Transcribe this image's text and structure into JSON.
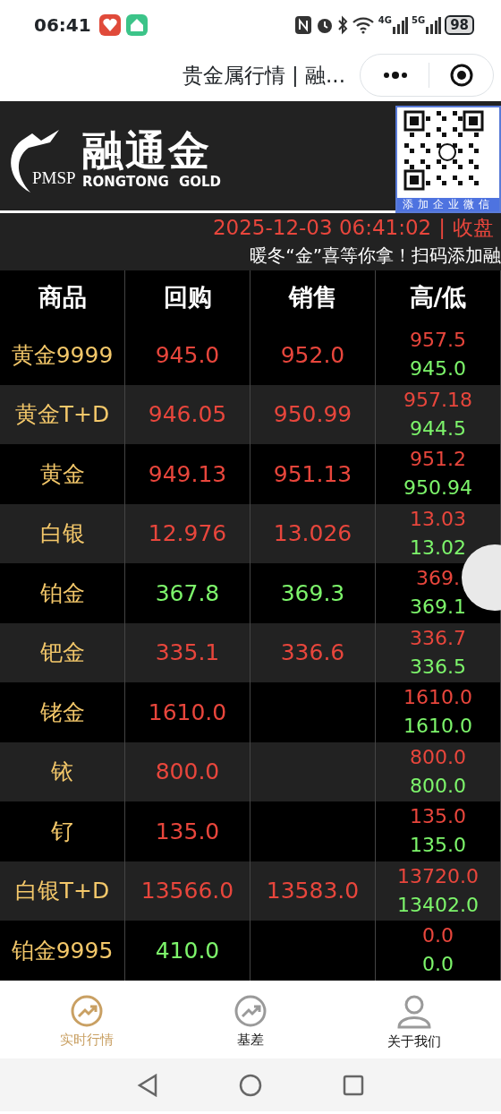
{
  "status_bar": {
    "time": "06:41",
    "network_1": "4G",
    "network_2": "5G",
    "battery": "98"
  },
  "window": {
    "title": "贵金属行情 | 融..."
  },
  "brand": {
    "emblem_text": "PMSP",
    "name": "融通金",
    "name_en": "RONGTONG GOLD",
    "qr_caption": "添加企业微信"
  },
  "market": {
    "datetime": "2025-12-03 06:41:02",
    "separator": "|",
    "status": "收盘",
    "notice": "暖冬“金”喜等你拿！扫码添加融"
  },
  "table": {
    "columns": [
      "商品",
      "回购",
      "销售",
      "高/低"
    ],
    "rows": [
      {
        "name": "黄金9999",
        "buy": "945.0",
        "sell": "952.0",
        "color": "#e8463c",
        "high": "957.5",
        "low": "945.0"
      },
      {
        "name": "黄金T+D",
        "buy": "946.05",
        "sell": "950.99",
        "color": "#e8463c",
        "high": "957.18",
        "low": "944.5"
      },
      {
        "name": "黄金",
        "buy": "949.13",
        "sell": "951.13",
        "color": "#e8463c",
        "high": "951.2",
        "low": "950.94"
      },
      {
        "name": "白银",
        "buy": "12.976",
        "sell": "13.026",
        "color": "#e8463c",
        "high": "13.03",
        "low": "13.02"
      },
      {
        "name": "铂金",
        "buy": "367.8",
        "sell": "369.3",
        "color": "#7df56b",
        "high": "369.",
        "low": "369.1"
      },
      {
        "name": "钯金",
        "buy": "335.1",
        "sell": "336.6",
        "color": "#e8463c",
        "high": "336.7",
        "low": "336.5"
      },
      {
        "name": "铑金",
        "buy": "1610.0",
        "color": "#e8463c",
        "high": "1610.0",
        "low": "1610.0"
      },
      {
        "name": "铱",
        "buy": "800.0",
        "color": "#e8463c",
        "high": "800.0",
        "low": "800.0"
      },
      {
        "name": "钌",
        "buy": "135.0",
        "color": "#e8463c",
        "high": "135.0",
        "low": "135.0"
      },
      {
        "name": "白银T+D",
        "buy": "13566.0",
        "sell": "13583.0",
        "color": "#e8463c",
        "high": "13720.0",
        "low": "13402.0"
      },
      {
        "name": "铂金9995",
        "buy": "410.0",
        "color": "#7df56b",
        "high": "0.0",
        "low": "0.0"
      }
    ]
  },
  "bottom_nav": [
    {
      "label": "实时行情",
      "kind": "trend",
      "selected": true
    },
    {
      "label": "基差",
      "kind": "trend",
      "selected": false
    },
    {
      "label": "关于我们",
      "kind": "person",
      "selected": false
    }
  ]
}
